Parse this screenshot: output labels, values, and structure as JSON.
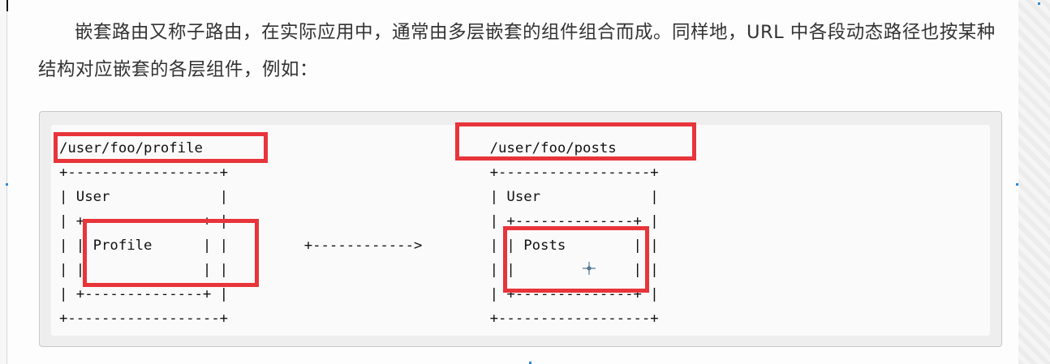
{
  "paragraph": {
    "text": "嵌套路由又称子路由，在实际应用中，通常由多层嵌套的组件组合而成。同样地，URL 中各段动态路径也按某种结构对应嵌套的各层组件，例如："
  },
  "code_block": {
    "lines": [
      "/user/foo/profile                                  /user/foo/posts",
      "+------------------+                               +------------------+",
      "| User             |                               | User             |",
      "| +--------------+ |                               | +--------------+ |",
      "| | Profile      | |         +------------>        | | Posts        | |",
      "| |              | |                               | |              | |",
      "| +--------------+ |                               | +--------------+ |",
      "+------------------+                               +------------------+"
    ]
  },
  "highlight_color": "#e8343a"
}
